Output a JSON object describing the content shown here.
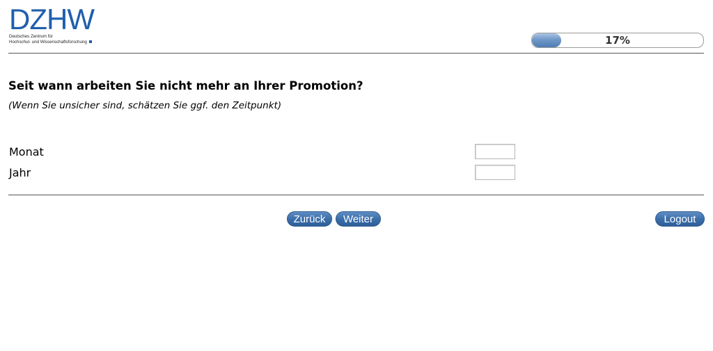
{
  "logo": {
    "mark": "DZHW",
    "line1": "Deutsches Zentrum für",
    "line2": "Hochschul- und Wissenschaftsforschung"
  },
  "progress": {
    "percent": 17,
    "label": "17%",
    "accent_color": "#4f7db4"
  },
  "question": {
    "title": "Seit wann arbeiten Sie nicht mehr an Ihrer Promotion?",
    "hint": "(Wenn Sie unsicher sind, schätzen Sie ggf. den Zeitpunkt)"
  },
  "fields": {
    "month_label": "Monat",
    "month_value": "",
    "year_label": "Jahr",
    "year_value": ""
  },
  "nav": {
    "back_label": "Zurück",
    "next_label": "Weiter",
    "logout_label": "Logout"
  }
}
